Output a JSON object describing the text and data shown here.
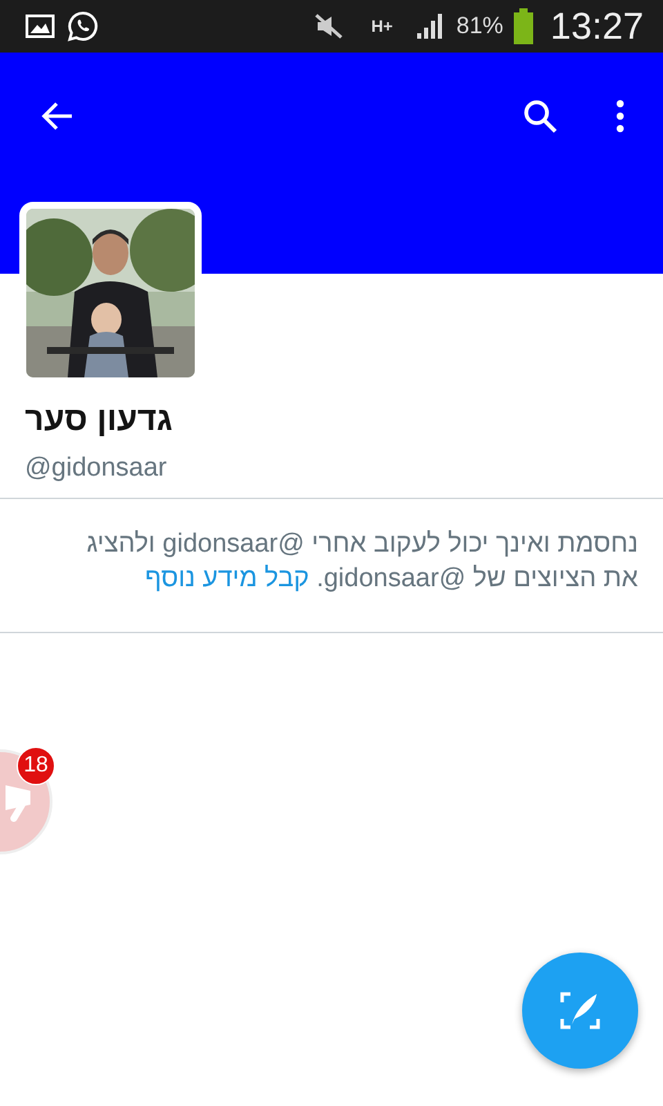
{
  "status_bar": {
    "network": "H+",
    "battery_percent": "81%",
    "time": "13:27"
  },
  "profile": {
    "name": "גדעון סער",
    "handle": "@gidonsaar"
  },
  "notice": {
    "text": "נחסמת ואינך יכול לעקוב אחרי @gidonsaar ולהציג את הציוצים של @gidonsaar.",
    "link": "קבל מידע נוסף"
  },
  "chat_head": {
    "badge": "18"
  }
}
